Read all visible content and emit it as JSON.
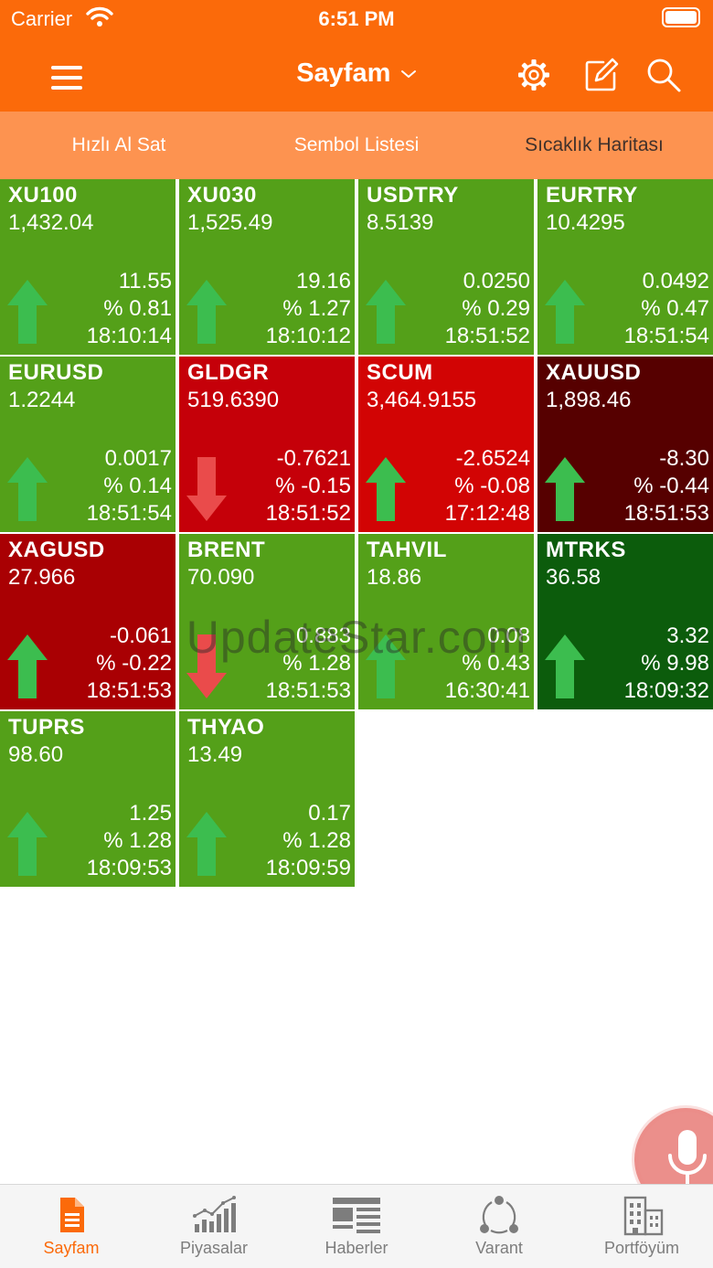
{
  "status": {
    "carrier": "Carrier",
    "time": "6:51 PM"
  },
  "nav": {
    "title": "Sayfam"
  },
  "tabs": [
    {
      "label": "Hızlı Al Sat",
      "active": false
    },
    {
      "label": "Sembol Listesi",
      "active": false
    },
    {
      "label": "Sıcaklık Haritası",
      "active": true
    }
  ],
  "colors": {
    "accent": "#fb6a0a",
    "tab_bar": "#fd9350",
    "green": "#54a019",
    "dark_green": "#0c5c0c",
    "red": "#d00808",
    "dark_red": "#a90003",
    "maroon": "#560000",
    "arrow_up": "#3cbd4f",
    "arrow_down": "#ea4b4b"
  },
  "tiles": [
    {
      "symbol": "XU100",
      "price": "1,432.04",
      "change": "11.55",
      "percent": "% 0.81",
      "time": "18:10:14",
      "direction": "up",
      "color": "#54a019"
    },
    {
      "symbol": "XU030",
      "price": "1,525.49",
      "change": "19.16",
      "percent": "% 1.27",
      "time": "18:10:12",
      "direction": "up",
      "color": "#54a019"
    },
    {
      "symbol": "USDTRY",
      "price": "8.5139",
      "change": "0.0250",
      "percent": "% 0.29",
      "time": "18:51:52",
      "direction": "up",
      "color": "#54a019"
    },
    {
      "symbol": "EURTRY",
      "price": "10.4295",
      "change": "0.0492",
      "percent": "% 0.47",
      "time": "18:51:54",
      "direction": "up",
      "color": "#54a019"
    },
    {
      "symbol": "EURUSD",
      "price": "1.2244",
      "change": "0.0017",
      "percent": "% 0.14",
      "time": "18:51:54",
      "direction": "up",
      "color": "#54a019"
    },
    {
      "symbol": "GLDGR",
      "price": "519.6390",
      "change": "-0.7621",
      "percent": "% -0.15",
      "time": "18:51:52",
      "direction": "down",
      "color": "#c50009"
    },
    {
      "symbol": "SCUM",
      "price": "3,464.9155",
      "change": "-2.6524",
      "percent": "% -0.08",
      "time": "17:12:48",
      "direction": "up",
      "color": "#d20404"
    },
    {
      "symbol": "XAUUSD",
      "price": "1,898.46",
      "change": "-8.30",
      "percent": "% -0.44",
      "time": "18:51:53",
      "direction": "up",
      "color": "#560000"
    },
    {
      "symbol": "XAGUSD",
      "price": "27.966",
      "change": "-0.061",
      "percent": "% -0.22",
      "time": "18:51:53",
      "direction": "up",
      "color": "#a90003"
    },
    {
      "symbol": "BRENT",
      "price": "70.090",
      "change": "0.883",
      "percent": "% 1.28",
      "time": "18:51:53",
      "direction": "down",
      "color": "#54a019"
    },
    {
      "symbol": "TAHVIL",
      "price": "18.86",
      "change": "0.08",
      "percent": "% 0.43",
      "time": "16:30:41",
      "direction": "up",
      "color": "#54a019"
    },
    {
      "symbol": "MTRKS",
      "price": "36.58",
      "change": "3.32",
      "percent": "% 9.98",
      "time": "18:09:32",
      "direction": "up",
      "color": "#0c5c0c"
    },
    {
      "symbol": "TUPRS",
      "price": "98.60",
      "change": "1.25",
      "percent": "% 1.28",
      "time": "18:09:53",
      "direction": "up",
      "color": "#54a019"
    },
    {
      "symbol": "THYAO",
      "price": "13.49",
      "change": "0.17",
      "percent": "% 1.28",
      "time": "18:09:59",
      "direction": "up",
      "color": "#54a019"
    }
  ],
  "watermark": "UpdateStar.com",
  "bottom_tabs": [
    {
      "label": "Sayfam",
      "icon": "document-icon",
      "active": true
    },
    {
      "label": "Piyasalar",
      "icon": "bar-chart-icon",
      "active": false
    },
    {
      "label": "Haberler",
      "icon": "newspaper-icon",
      "active": false
    },
    {
      "label": "Varant",
      "icon": "network-icon",
      "active": false
    },
    {
      "label": "Portföyüm",
      "icon": "buildings-icon",
      "active": false
    }
  ]
}
